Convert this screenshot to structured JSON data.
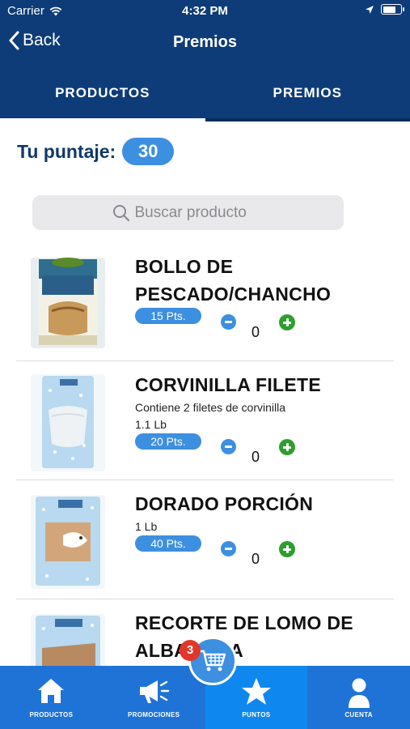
{
  "status_bar": {
    "carrier": "Carrier",
    "time": "4:32 PM",
    "battery_level": 0.75
  },
  "nav": {
    "back_label": "Back",
    "title": "Premios"
  },
  "tabs": [
    {
      "label": "PRODUCTOS",
      "active": true
    },
    {
      "label": "PREMIOS",
      "active": false
    }
  ],
  "score": {
    "label": "Tu puntaje:",
    "value": "30"
  },
  "search": {
    "placeholder": "Buscar producto"
  },
  "products": [
    {
      "title": "BOLLO DE PESCADO/CHANCHO",
      "description": "",
      "weight": "",
      "points": "15 Pts.",
      "quantity": "0"
    },
    {
      "title": "CORVINILLA FILETE",
      "description": "Contiene 2 filetes de corvinilla",
      "weight": "1.1 Lb",
      "points": "20 Pts.",
      "quantity": "0"
    },
    {
      "title": "DORADO PORCIÓN",
      "description": "",
      "weight": "1 Lb",
      "points": "40 Pts.",
      "quantity": "0"
    },
    {
      "title": "RECORTE DE LOMO DE ALBACORA",
      "description": "",
      "weight": "",
      "points": "",
      "quantity": ""
    }
  ],
  "cart": {
    "badge_count": "3"
  },
  "tab_bar": [
    {
      "label": "PRODUCTOS",
      "icon": "home-icon",
      "active": false
    },
    {
      "label": "PROMOCIONES",
      "icon": "megaphone-icon",
      "active": false
    },
    {
      "label": "PUNTOS",
      "icon": "star-icon",
      "active": true
    },
    {
      "label": "CUENTA",
      "icon": "user-icon",
      "active": false
    }
  ],
  "colors": {
    "primary_dark": "#0e3c78",
    "accent_blue": "#3d8fe0",
    "plus_green": "#2e9e2e",
    "badge_red": "#e3352a",
    "tabbar_blue": "#1f73d6"
  }
}
